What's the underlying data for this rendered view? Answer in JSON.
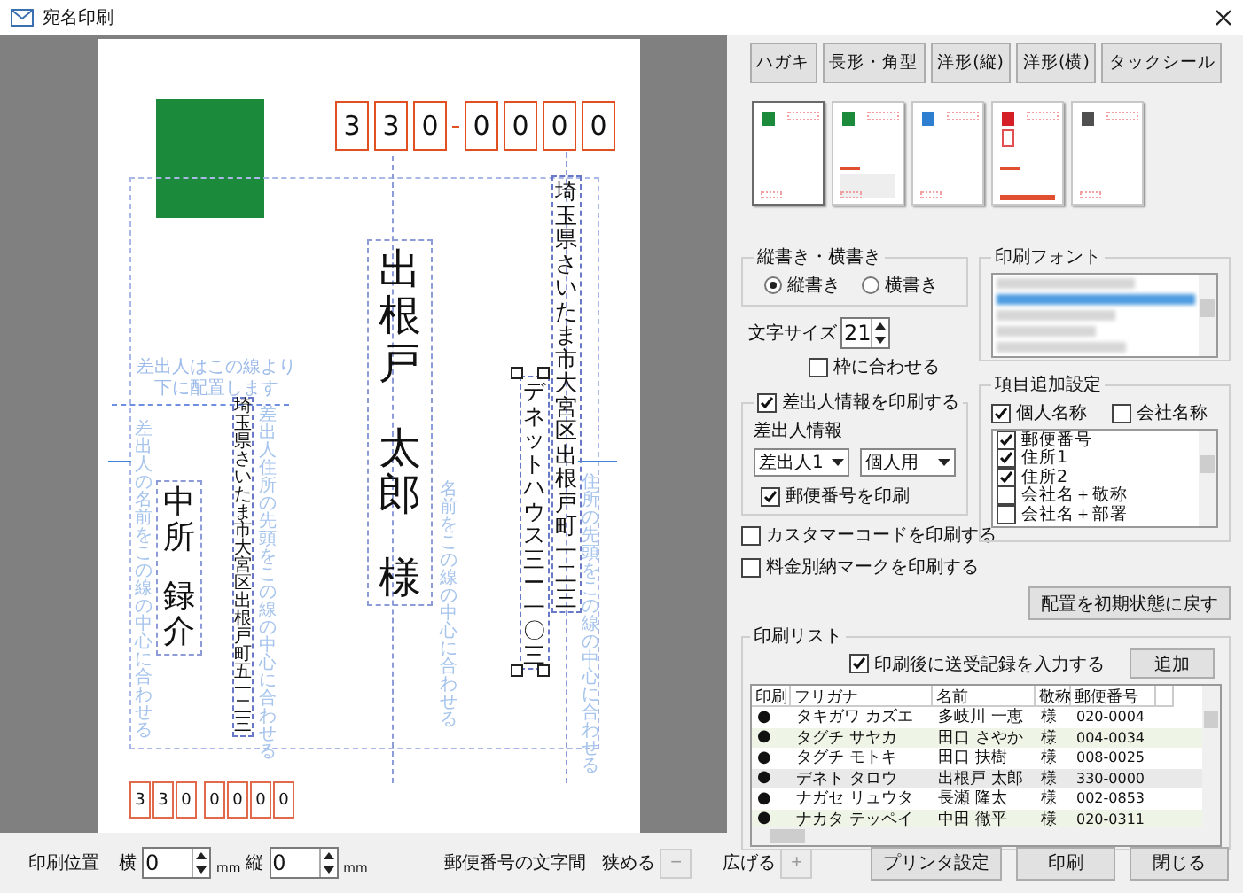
{
  "window": {
    "title": "宛名印刷"
  },
  "preview": {
    "postal_code": [
      "3",
      "3",
      "0",
      "0",
      "0",
      "0",
      "0"
    ],
    "recipient": {
      "family_name": "出根戸",
      "given_name": "太郎",
      "honorific": "様",
      "address_1": "埼玉県さいたま市大宮区出根戸町一二三",
      "address_2": "デネットハウス三ー一〇三"
    },
    "sender_note": [
      "差出人はこの線より",
      "下に配置します"
    ],
    "sender": {
      "family_name": "中所",
      "given_name": "録介",
      "address": "埼玉県さいたま市大宮区出根戸町五一二三",
      "postal_code": [
        "3",
        "3",
        "0",
        "0",
        "0",
        "0",
        "0"
      ]
    },
    "guides": [
      {
        "kind": "sender_name",
        "text": "差出人の名前をこの線の中心に合わせる"
      },
      {
        "kind": "sender_address",
        "text": "差出人住所の先頭をこの線の中心に合わせる"
      },
      {
        "kind": "name",
        "text": "名前をこの線の中心に合わせる"
      },
      {
        "kind": "address",
        "text": "住所の先頭をこの線の中心に合わせる"
      }
    ]
  },
  "envelope_types": [
    "ハガキ",
    "長形・角型",
    "洋形(縦)",
    "洋形(横)",
    "タックシール"
  ],
  "layouts": [
    {
      "kind": "plain",
      "color": "#1b8a3a",
      "selected": true
    },
    {
      "kind": "panel",
      "color": "#1b8a3a",
      "selected": false
    },
    {
      "kind": "plain",
      "color": "#2f7fd0",
      "selected": false
    },
    {
      "kind": "mark",
      "color": "#d41f26",
      "selected": false
    },
    {
      "kind": "plain",
      "color": "#505050",
      "selected": false
    }
  ],
  "orientation": {
    "title": "縦書き・横書き",
    "options": [
      {
        "label": "縦書き",
        "selected": true
      },
      {
        "label": "横書き",
        "selected": false
      }
    ]
  },
  "font_size": {
    "label": "文字サイズ",
    "value": "21"
  },
  "fit_to_frame": {
    "label": "枠に合わせる",
    "checked": false
  },
  "print_font": {
    "title": "印刷フォント"
  },
  "sender_info": {
    "label": "差出人情報を印刷する",
    "checked": true,
    "caption": "差出人情報",
    "sender_select": "差出人1",
    "type_select": "個人用",
    "postal": {
      "label": "郵便番号を印刷",
      "checked": true
    }
  },
  "options": [
    {
      "label": "カスタマーコードを印刷する",
      "checked": false
    },
    {
      "label": "料金別納マークを印刷する",
      "checked": false
    }
  ],
  "extra_items": {
    "title": "項目追加設定",
    "toggles": [
      {
        "label": "個人名称",
        "checked": true
      },
      {
        "label": "会社名称",
        "checked": false
      }
    ],
    "items": [
      {
        "label": "郵便番号",
        "checked": true
      },
      {
        "label": "住所1",
        "checked": true
      },
      {
        "label": "住所2",
        "checked": true
      },
      {
        "label": "会社名＋敬称",
        "checked": false
      },
      {
        "label": "会社名＋部署",
        "checked": false
      }
    ]
  },
  "reset_button": "配置を初期状態に戻す",
  "print_list": {
    "title": "印刷リスト",
    "record": {
      "label": "印刷後に送受記録を入力する",
      "checked": true
    },
    "add_button": "追加",
    "columns": [
      "印刷",
      "フリガナ",
      "名前",
      "敬称",
      "郵便番号"
    ],
    "rows": [
      {
        "mark": "●",
        "furigana": "タキガワ カズエ",
        "name": "多岐川 一恵",
        "honorific": "様",
        "postal": "020-0004",
        "selected": false
      },
      {
        "mark": "●",
        "furigana": "タグチ サヤカ",
        "name": "田口 さやか",
        "honorific": "様",
        "postal": "004-0034",
        "selected": false
      },
      {
        "mark": "●",
        "furigana": "タグチ モトキ",
        "name": "田口 扶樹",
        "honorific": "様",
        "postal": "008-0025",
        "selected": false
      },
      {
        "mark": "●",
        "furigana": "デネト タロウ",
        "name": "出根戸 太郎",
        "honorific": "様",
        "postal": "330-0000",
        "selected": true
      },
      {
        "mark": "●",
        "furigana": "ナガセ リュウタ",
        "name": "長瀬 隆太",
        "honorific": "様",
        "postal": "002-0853",
        "selected": false
      },
      {
        "mark": "●",
        "furigana": "ナカタ テッペイ",
        "name": "中田 徹平",
        "honorific": "様",
        "postal": "020-0311",
        "selected": false
      }
    ]
  },
  "bottom": {
    "position_label": "印刷位置",
    "x_label": "横",
    "x_value": "0",
    "x_unit": "mm",
    "y_label": "縦",
    "y_value": "0",
    "y_unit": "mm",
    "spacing_label": "郵便番号の文字間",
    "narrow": {
      "label": "狭める",
      "button": "−",
      "disabled": true
    },
    "widen": {
      "label": "広げる",
      "button": "+",
      "disabled": true
    },
    "buttons": [
      "プリンタ設定",
      "印刷",
      "閉じる"
    ]
  }
}
